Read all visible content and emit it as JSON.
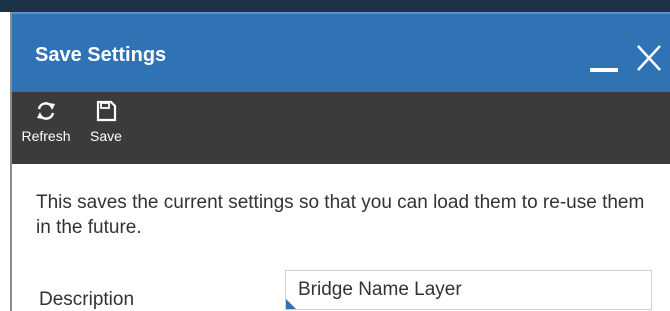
{
  "window": {
    "title": "Save Settings"
  },
  "toolbar": {
    "refresh_label": "Refresh",
    "save_label": "Save"
  },
  "content": {
    "description_text": "This saves the current settings so that you can load them to re-use them in the future.",
    "description_label": "Description",
    "description_value": "Bridge Name Layer"
  },
  "icons": {
    "minimize": "minimize-icon",
    "close": "close-icon",
    "refresh": "refresh-icon",
    "save": "save-icon"
  },
  "colors": {
    "titlebar": "#2f73b5",
    "toolbar": "#3b3b3b",
    "top_strip": "#1c3347"
  }
}
